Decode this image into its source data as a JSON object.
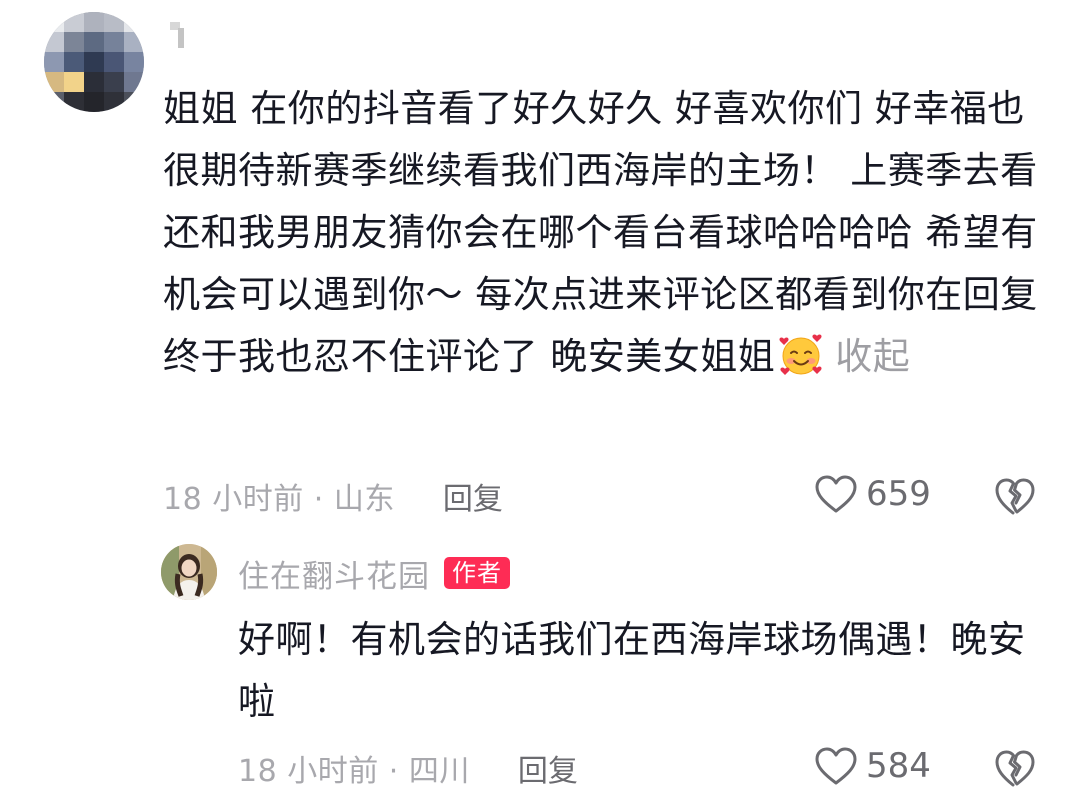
{
  "comment": {
    "text": "姐姐 在你的抖音看了好久好久 好喜欢你们 好幸福也很期待新赛季继续看我们西海岸的主场！ 上赛季去看还和我男朋友猜你会在哪个看台看球哈哈哈哈 希望有机会可以遇到你～ 每次点进来评论区都看到你在回复 终于我也忍不住评论了 晚安美女姐姐",
    "emoji": "smiling-face-with-hearts",
    "collapse_label": "收起",
    "time_location": "18 小时前 · 山东",
    "reply_label": "回复",
    "like_count": "659"
  },
  "reply": {
    "username": "住在翻斗花园",
    "badge": "作者",
    "text": "好啊！有机会的话我们在西海岸球场偶遇！晚安啦",
    "time_location": "18 小时前 · 四川",
    "reply_label": "回复",
    "like_count": "584"
  },
  "icons": {
    "like": "heart-outline-icon",
    "dislike": "broken-heart-icon"
  },
  "colors": {
    "text": "#161823",
    "muted": "#a8a8ad",
    "reply_action": "#6b6b70",
    "author_badge": "#fe2c55"
  }
}
